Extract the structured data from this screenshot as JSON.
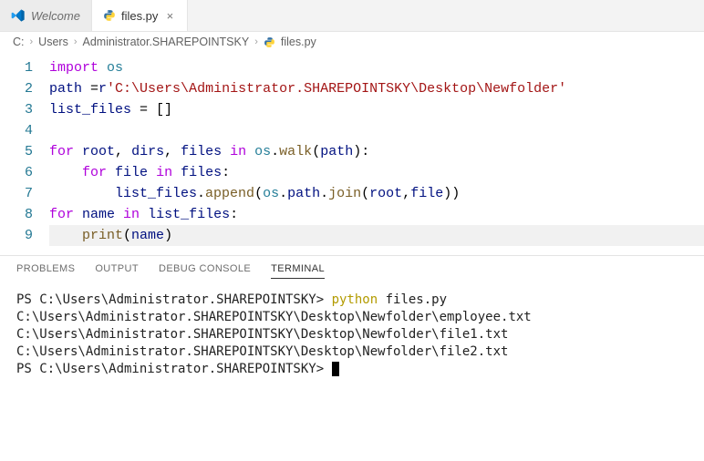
{
  "tabs": [
    {
      "label": "Welcome",
      "active": false,
      "icon": "vscode"
    },
    {
      "label": "files.py",
      "active": true,
      "icon": "python"
    }
  ],
  "breadcrumb": {
    "segments": [
      "C:",
      "Users",
      "Administrator.SHAREPOINTSKY"
    ],
    "file_icon": "python",
    "file": "files.py"
  },
  "editor": {
    "lines": [
      {
        "n": 1,
        "indent": 0,
        "tokens": [
          [
            "kw",
            "import"
          ],
          [
            "op",
            " "
          ],
          [
            "mod",
            "os"
          ]
        ]
      },
      {
        "n": 2,
        "indent": 0,
        "tokens": [
          [
            "var",
            "path "
          ],
          [
            "op",
            "="
          ],
          [
            "var",
            "r"
          ],
          [
            "str",
            "'C:\\Users\\Administrator.SHAREPOINTSKY\\Desktop\\Newfolder'"
          ]
        ]
      },
      {
        "n": 3,
        "indent": 0,
        "tokens": [
          [
            "var",
            "list_files "
          ],
          [
            "op",
            "= []"
          ]
        ]
      },
      {
        "n": 4,
        "indent": 0,
        "tokens": []
      },
      {
        "n": 5,
        "indent": 0,
        "tokens": [
          [
            "kw",
            "for"
          ],
          [
            "op",
            " "
          ],
          [
            "var",
            "root"
          ],
          [
            "op",
            ", "
          ],
          [
            "var",
            "dirs"
          ],
          [
            "op",
            ", "
          ],
          [
            "var",
            "files "
          ],
          [
            "kw",
            "in"
          ],
          [
            "op",
            " "
          ],
          [
            "mod",
            "os"
          ],
          [
            "op",
            "."
          ],
          [
            "fn",
            "walk"
          ],
          [
            "op",
            "("
          ],
          [
            "var",
            "path"
          ],
          [
            "op",
            "):"
          ]
        ]
      },
      {
        "n": 6,
        "indent": 1,
        "tokens": [
          [
            "kw",
            "for"
          ],
          [
            "op",
            " "
          ],
          [
            "var",
            "file "
          ],
          [
            "kw",
            "in"
          ],
          [
            "op",
            " "
          ],
          [
            "var",
            "files"
          ],
          [
            "op",
            ":"
          ]
        ]
      },
      {
        "n": 7,
        "indent": 2,
        "tokens": [
          [
            "var",
            "list_files"
          ],
          [
            "op",
            "."
          ],
          [
            "fn",
            "append"
          ],
          [
            "op",
            "("
          ],
          [
            "mod",
            "os"
          ],
          [
            "op",
            "."
          ],
          [
            "var",
            "path"
          ],
          [
            "op",
            "."
          ],
          [
            "fn",
            "join"
          ],
          [
            "op",
            "("
          ],
          [
            "var",
            "root"
          ],
          [
            "op",
            ","
          ],
          [
            "var",
            "file"
          ],
          [
            "op",
            "))"
          ]
        ]
      },
      {
        "n": 8,
        "indent": 0,
        "tokens": [
          [
            "kw",
            "for"
          ],
          [
            "op",
            " "
          ],
          [
            "var",
            "name "
          ],
          [
            "kw",
            "in"
          ],
          [
            "op",
            " "
          ],
          [
            "var",
            "list_files"
          ],
          [
            "op",
            ":"
          ]
        ]
      },
      {
        "n": 9,
        "indent": 1,
        "hl": true,
        "tokens": [
          [
            "fn",
            "print"
          ],
          [
            "op",
            "("
          ],
          [
            "var",
            "name"
          ],
          [
            "op",
            ")"
          ]
        ]
      }
    ]
  },
  "panel": {
    "tabs": [
      "PROBLEMS",
      "OUTPUT",
      "DEBUG CONSOLE",
      "TERMINAL"
    ],
    "active": "TERMINAL"
  },
  "terminal": {
    "prompt1_prefix": "PS C:\\Users\\Administrator.SHAREPOINTSKY> ",
    "prompt1_cmd_py": "python",
    "prompt1_cmd_arg": " files.py",
    "outputs": [
      "C:\\Users\\Administrator.SHAREPOINTSKY\\Desktop\\Newfolder\\employee.txt",
      "C:\\Users\\Administrator.SHAREPOINTSKY\\Desktop\\Newfolder\\file1.txt",
      "C:\\Users\\Administrator.SHAREPOINTSKY\\Desktop\\Newfolder\\file2.txt"
    ],
    "prompt2": "PS C:\\Users\\Administrator.SHAREPOINTSKY> "
  }
}
